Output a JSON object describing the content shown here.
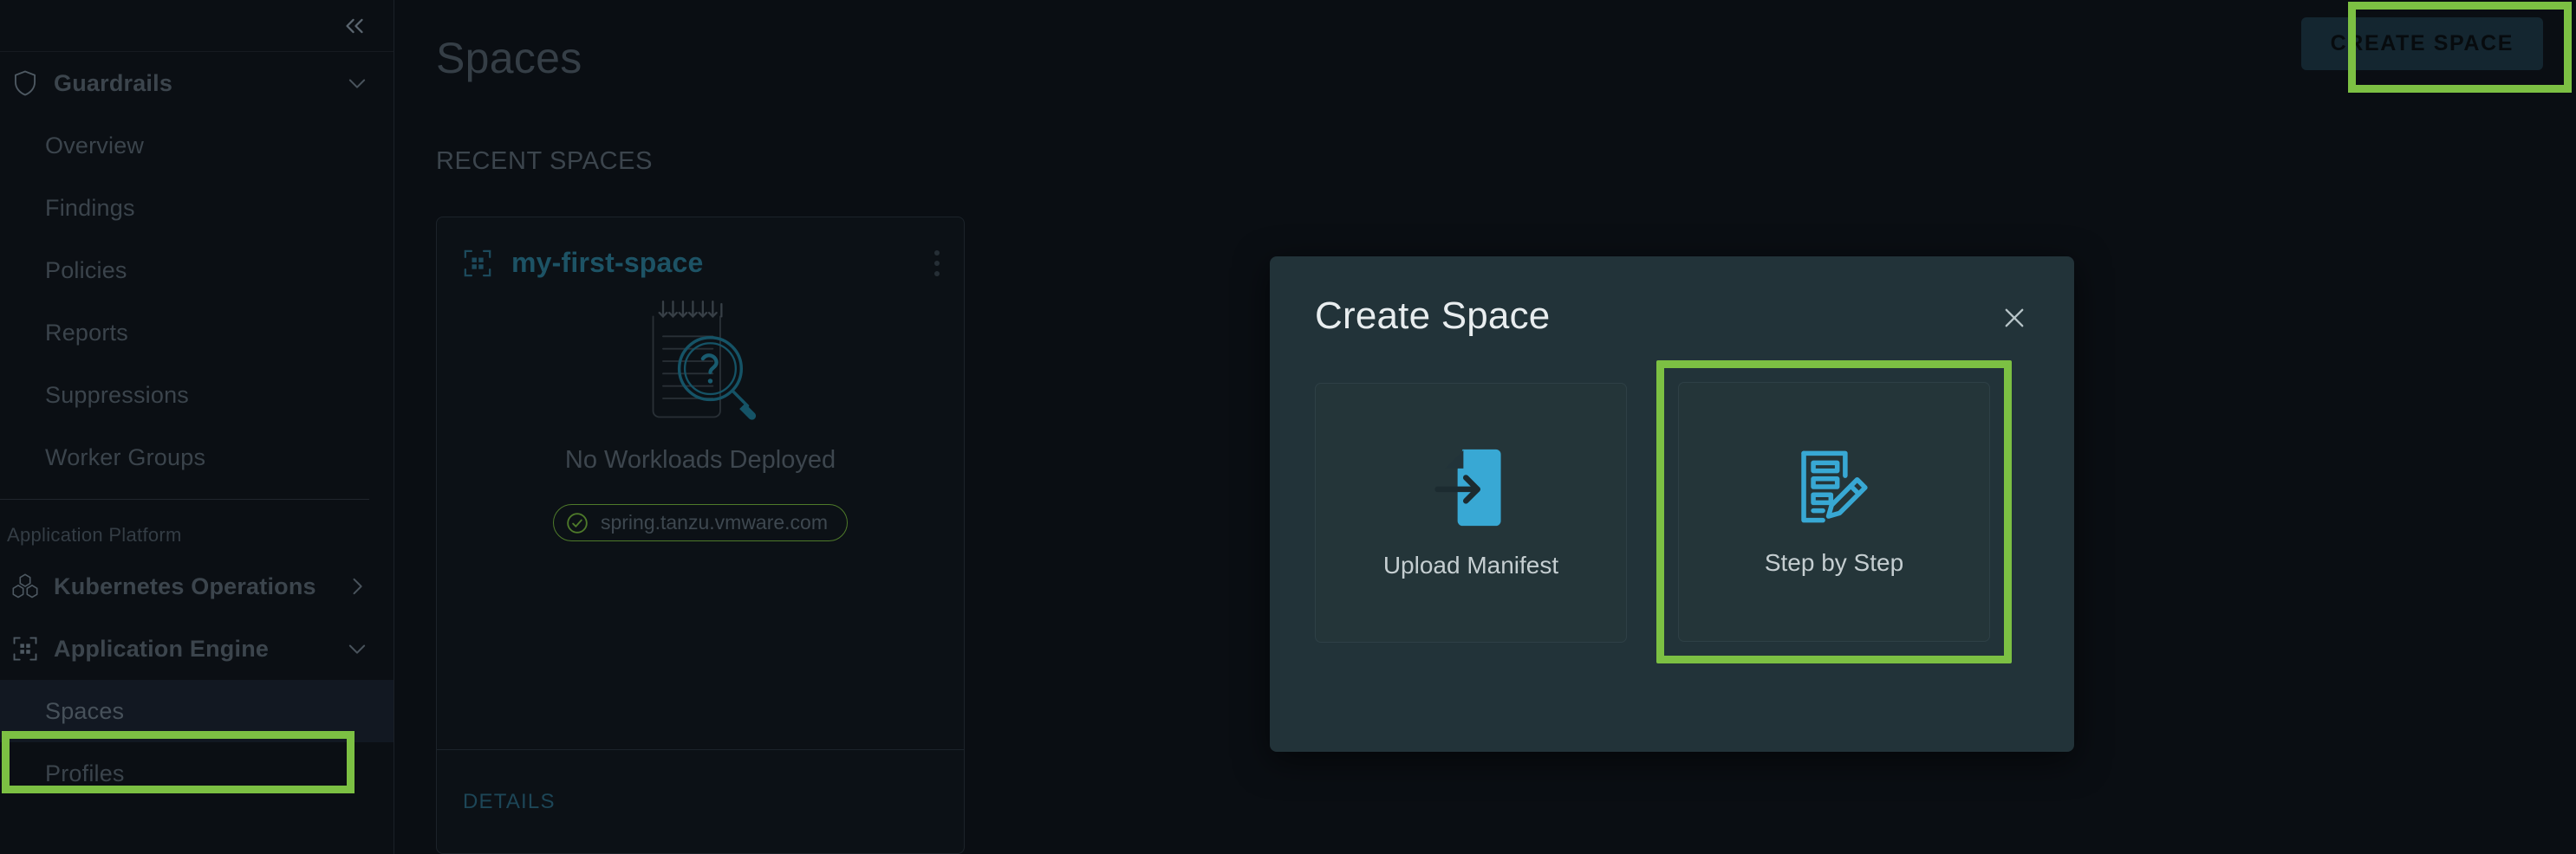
{
  "accent": {
    "green": "#7cc043",
    "blue": "#38a8d4",
    "teal": "#1d5365"
  },
  "sidebar": {
    "collapse_icon": "chevrons-left-icon",
    "groups": [
      {
        "label": "Guardrails",
        "icon": "shield-icon",
        "chevron": "chevron-down-icon",
        "items": [
          {
            "label": "Overview"
          },
          {
            "label": "Findings"
          },
          {
            "label": "Policies"
          },
          {
            "label": "Reports"
          },
          {
            "label": "Suppressions"
          },
          {
            "label": "Worker Groups"
          }
        ]
      }
    ],
    "section_label": "Application Platform",
    "platform_groups": [
      {
        "label": "Kubernetes Operations",
        "icon": "hexagons-icon",
        "chevron": "chevron-right-icon"
      },
      {
        "label": "Application Engine",
        "icon": "grid-brackets-icon",
        "chevron": "chevron-down-icon"
      }
    ],
    "platform_items": [
      {
        "label": "Spaces",
        "active": true
      },
      {
        "label": "Profiles",
        "active": false
      }
    ]
  },
  "header": {
    "title": "Spaces",
    "create_button": "CREATE SPACE"
  },
  "main": {
    "section_label": "RECENT SPACES",
    "card": {
      "icon": "space-grid-icon",
      "title": "my-first-space",
      "kebab": "more-options-icon",
      "empty_illustration": "document-search-icon",
      "empty_text": "No Workloads Deployed",
      "badge": {
        "icon": "check-circle-icon",
        "text": "spring.tanzu.vmware.com"
      },
      "footer_label": "DETAILS"
    }
  },
  "modal": {
    "title": "Create Space",
    "close_icon": "close-icon",
    "options": [
      {
        "label": "Upload Manifest",
        "icon": "upload-document-icon",
        "highlighted": false
      },
      {
        "label": "Step by Step",
        "icon": "document-pencil-icon",
        "highlighted": true
      }
    ]
  },
  "annotations": {
    "create_space_button_box": "highlight-create-space",
    "sidebar_spaces_box": "highlight-sidebar-spaces",
    "step_by_step_box": "highlight-step-by-step"
  }
}
